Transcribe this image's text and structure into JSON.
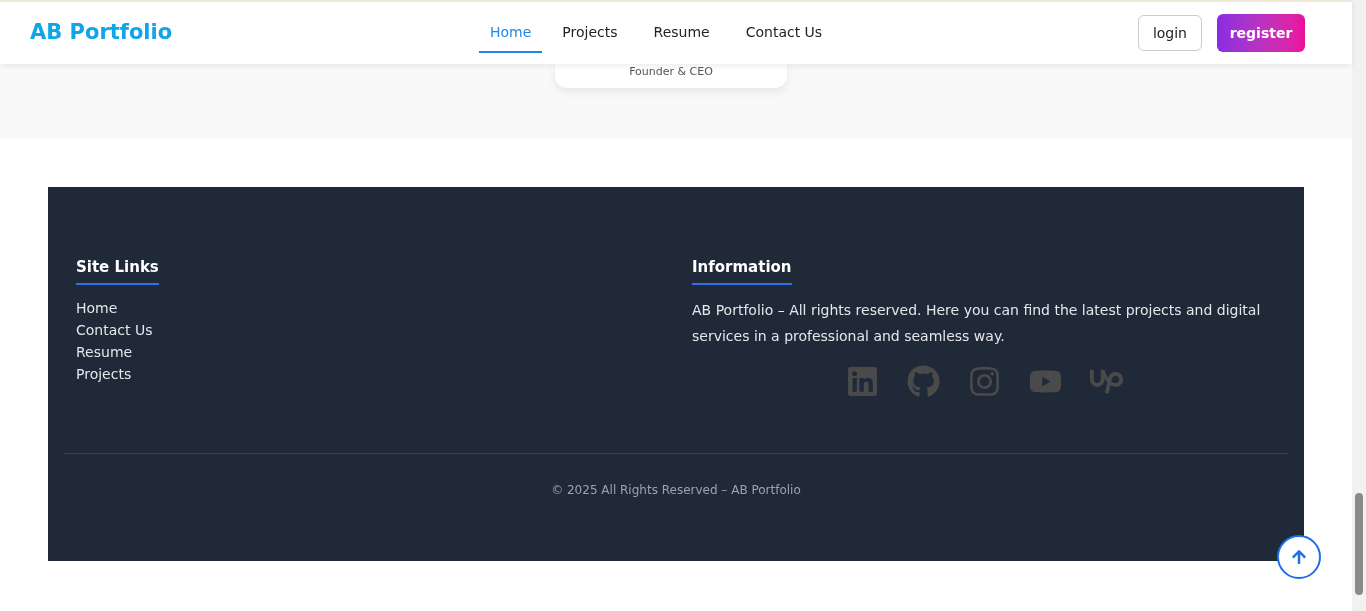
{
  "header": {
    "brand": "AB Portfolio",
    "nav": [
      {
        "label": "Home",
        "selected": true
      },
      {
        "label": "Projects",
        "selected": false
      },
      {
        "label": "Resume",
        "selected": false
      },
      {
        "label": "Contact Us",
        "selected": false
      }
    ],
    "login": "login",
    "register": "register"
  },
  "card": {
    "role": "Founder & CEO"
  },
  "footer": {
    "site_links": {
      "title": "Site Links",
      "links": [
        "Home",
        "Contact Us",
        "Resume",
        "Projects"
      ]
    },
    "information": {
      "title": "Information",
      "text": "AB Portfolio – All rights reserved. Here you can find the latest projects and digital services in a professional and seamless way."
    },
    "copyright": "© 2025 All Rights Reserved – AB Portfolio"
  }
}
